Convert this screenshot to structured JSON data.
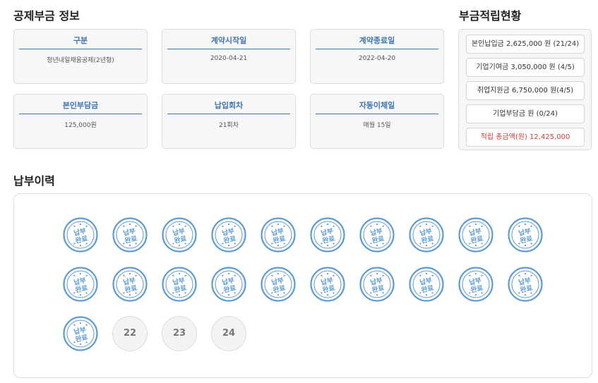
{
  "sections": {
    "info_title": "공제부금 정보",
    "status_title": "부금적립현황",
    "history_title": "납부이력"
  },
  "info_cards": [
    {
      "label": "구분",
      "value": "청년내일채움공제(2년형)"
    },
    {
      "label": "계약시작일",
      "value": "2020-04-21"
    },
    {
      "label": "계약종료일",
      "value": "2022-04-20"
    },
    {
      "label": "본인부담금",
      "value": "125,000원"
    },
    {
      "label": "납입회차",
      "value": "21회차"
    },
    {
      "label": "자동이체일",
      "value": "매월 15일"
    }
  ],
  "status_items": [
    "본인납입금 2,625,000 원 (21/24)",
    "기업기여금 3,050,000 원 (4/5)",
    "취업지원금 6,750,000 원(4/5)",
    "기업부담금 원 (0/24)"
  ],
  "status_total": {
    "label": "적립 총금액(원)",
    "value": "12,425,000"
  },
  "history": {
    "completed_count": 21,
    "stamp_text_line1": "납부",
    "stamp_text_line2": "완료",
    "remaining": [
      "22",
      "23",
      "24"
    ]
  },
  "colors": {
    "accent": "#3f74b5",
    "stamp": "#5b9bd5",
    "total": "#d53a3a"
  },
  "icons": {
    "stamp": "paid-stamp-icon"
  }
}
